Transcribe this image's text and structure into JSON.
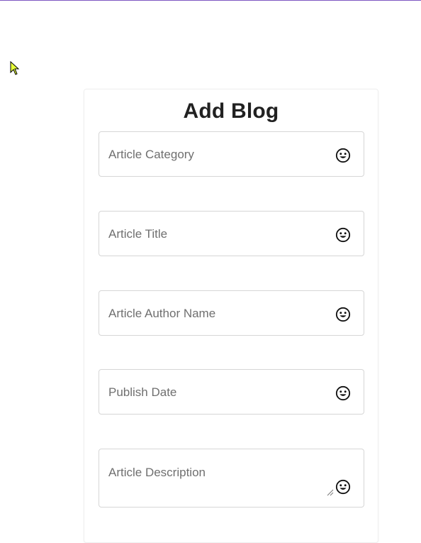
{
  "form": {
    "title": "Add Blog",
    "fields": [
      {
        "placeholder": "Article Category",
        "icon": "emoji-smile-icon"
      },
      {
        "placeholder": "Article Title",
        "icon": "emoji-smile-icon"
      },
      {
        "placeholder": "Article Author Name",
        "icon": "emoji-smile-icon"
      },
      {
        "placeholder": "Publish Date",
        "icon": "emoji-smile-icon"
      },
      {
        "placeholder": "Article Description",
        "icon": "emoji-smile-icon"
      }
    ]
  },
  "colors": {
    "accent_line": "#7e57c2",
    "title": "#212121",
    "placeholder": "#6f6f6f",
    "border": "#d6d6d6"
  }
}
